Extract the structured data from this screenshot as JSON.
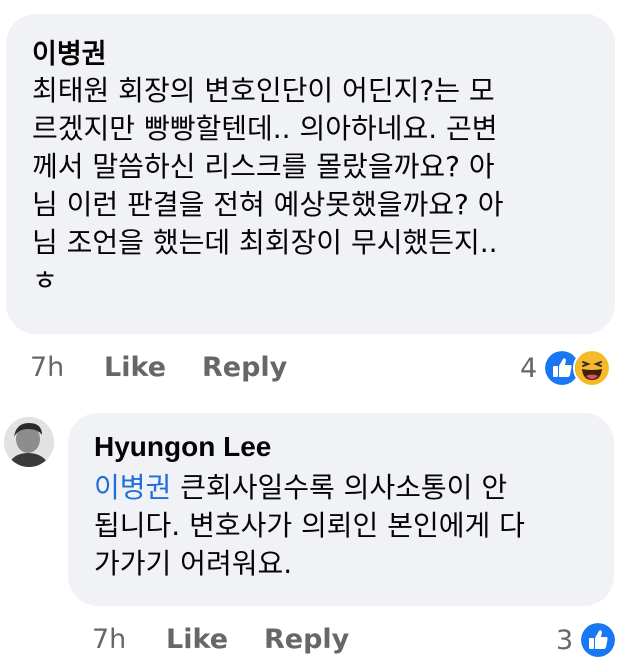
{
  "comment1": {
    "author": "이병권",
    "lines": [
      "최태원 회장의 변호인단이 어딘지?는 모",
      "르겠지만 빵빵할텐데.. 의아하네요. 곤변",
      "께서 말씀하신 리스크를 몰랐을까요? 아",
      "님 이런 판결을 전혀 예상못했을까요? 아",
      "님 조언을 했는데 최회장이 무시했든지..",
      "ㅎ"
    ],
    "time": "7h",
    "like_label": "Like",
    "reply_label": "Reply",
    "reaction_count": "4",
    "reactions": [
      "like-icon",
      "haha-icon"
    ]
  },
  "comment2": {
    "author": "Hyungon Lee",
    "mention": "이병권",
    "line1_rest": " 큰회사일수록 의사소통이 안",
    "lines": [
      "됩니다. 변호사가 의뢰인 본인에게 다",
      "가가기 어려워요."
    ],
    "time": "7h",
    "like_label": "Like",
    "reply_label": "Reply",
    "reaction_count": "3",
    "reactions": [
      "like-icon"
    ]
  },
  "colors": {
    "bubble": "#f0f2f5",
    "mention": "#216fdb",
    "meta": "#65676b",
    "like_blue": "#1877f2",
    "haha_yellow": "#f7b928"
  }
}
